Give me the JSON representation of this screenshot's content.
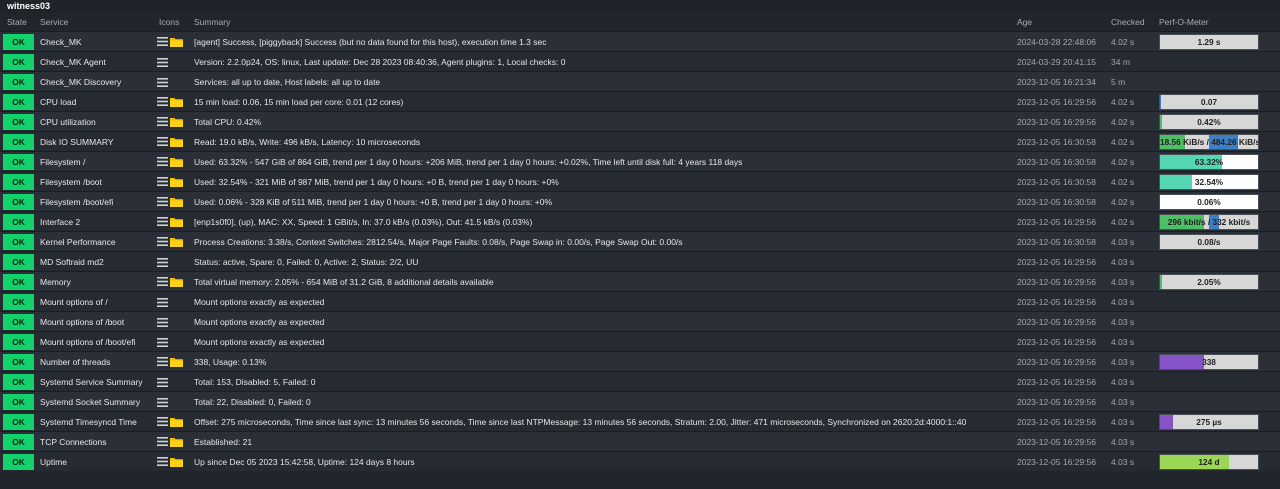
{
  "host": {
    "name": "witness03"
  },
  "columns": {
    "state": "State",
    "service": "Service",
    "icons": "Icons",
    "summary": "Summary",
    "age": "Age",
    "checked": "Checked",
    "perf": "Perf-O-Meter"
  },
  "ok_label": "OK",
  "colors": {
    "ok": "#14d26b",
    "perf_background": "#d7d7d7",
    "perf_teal": "#54d6b4",
    "perf_green": "#4fbf67",
    "perf_blue": "#3b7fc4",
    "perf_purple": "#8653c8",
    "perf_lime": "#9cd655"
  },
  "rows": [
    {
      "state": "OK",
      "service": "Check_MK",
      "icons": [
        "menu-icon",
        "folder-icon"
      ],
      "summary": "[agent] Success, [piggyback] Success (but no data found for this host), execution time 1.3 sec",
      "age": "2024-03-28 22:48:06",
      "checked": "4.02 s",
      "perf": {
        "text": "1.29 s",
        "fill": 0,
        "color": "#54d6b4"
      }
    },
    {
      "state": "OK",
      "service": "Check_MK Agent",
      "icons": [
        "menu-icon"
      ],
      "summary": "Version: 2.2.0p24, OS: linux, Last update: Dec 28 2023 08:40:36, Agent plugins: 1, Local checks: 0",
      "age": "2024-03-29 20:41:15",
      "checked": "34 m",
      "perf": null
    },
    {
      "state": "OK",
      "service": "Check_MK Discovery",
      "icons": [
        "menu-icon"
      ],
      "summary": "Services: all up to date, Host labels: all up to date",
      "age": "2023-12-05 16:21:34",
      "checked": "5 m",
      "perf": null
    },
    {
      "state": "OK",
      "service": "CPU load",
      "icons": [
        "menu-icon",
        "folder-icon"
      ],
      "summary": "15 min load: 0.06, 15 min load per core: 0.01 (12 cores)",
      "age": "2023-12-05 16:29:56",
      "checked": "4.02 s",
      "perf": {
        "text": "0.07",
        "fill": 0.01,
        "color": "#3b7fc4"
      }
    },
    {
      "state": "OK",
      "service": "CPU utilization",
      "icons": [
        "menu-icon",
        "folder-icon"
      ],
      "summary": "Total CPU: 0.42%",
      "age": "2023-12-05 16:29:56",
      "checked": "4.02 s",
      "perf": {
        "text": "0.42%",
        "fill": 0.02,
        "color": "#4fbf67"
      }
    },
    {
      "state": "OK",
      "service": "Disk IO SUMMARY",
      "icons": [
        "menu-icon",
        "folder-icon"
      ],
      "summary": "Read: 19.0 kB/s, Write: 496 kB/s, Latency: 10 microseconds",
      "age": "2023-12-05 16:30:58",
      "checked": "4.02 s",
      "perf": {
        "text": "18.56 KiB/s / 484.26 KiB/s",
        "fill": 0.25,
        "color": "#4fbf67",
        "fill2": 0.3,
        "color2": "#3b7fc4"
      }
    },
    {
      "state": "OK",
      "service": "Filesystem /",
      "icons": [
        "menu-icon",
        "folder-icon"
      ],
      "summary": "Used: 63.32% - 547 GiB of 864 GiB, trend per 1 day 0 hours: +206 MiB, trend per 1 day 0 hours: +0.02%, Time left until disk full: 4 years 118 days",
      "age": "2023-12-05 16:30:58",
      "checked": "4.02 s",
      "perf": {
        "text": "63.32%",
        "fill": 0.6332,
        "color": "#54d6b4",
        "bg": "#ffffff"
      }
    },
    {
      "state": "OK",
      "service": "Filesystem /boot",
      "icons": [
        "menu-icon",
        "folder-icon"
      ],
      "summary": "Used: 32.54% - 321 MiB of 987 MiB, trend per 1 day 0 hours: +0 B, trend per 1 day 0 hours: +0%",
      "age": "2023-12-05 16:30:58",
      "checked": "4.02 s",
      "perf": {
        "text": "32.54%",
        "fill": 0.3254,
        "color": "#54d6b4",
        "bg": "#ffffff"
      }
    },
    {
      "state": "OK",
      "service": "Filesystem /boot/efi",
      "icons": [
        "menu-icon",
        "folder-icon"
      ],
      "summary": "Used: 0.06% - 328 KiB of 511 MiB, trend per 1 day 0 hours: +0 B, trend per 1 day 0 hours: +0%",
      "age": "2023-12-05 16:30:58",
      "checked": "4.02 s",
      "perf": {
        "text": "0.06%",
        "fill": 0.0006,
        "color": "#54d6b4",
        "bg": "#ffffff"
      }
    },
    {
      "state": "OK",
      "service": "Interface 2",
      "icons": [
        "menu-icon",
        "folder-icon"
      ],
      "summary": "[enp1s0f0], (up), MAC: XX, Speed: 1 GBit/s, In: 37.0 kB/s (0.03%), Out: 41.5 kB/s (0.03%)",
      "age": "2023-12-05 16:29:56",
      "checked": "4.02 s",
      "perf": {
        "text": "296 kbit/s / 332 kbit/s",
        "fill": 0.45,
        "color": "#4fbf67",
        "fill2": 0.1,
        "color2": "#3b7fc4"
      }
    },
    {
      "state": "OK",
      "service": "Kernel Performance",
      "icons": [
        "menu-icon",
        "folder-icon"
      ],
      "summary": "Process Creations: 3.38/s, Context Switches: 2812.54/s, Major Page Faults: 0.08/s, Page Swap in: 0.00/s, Page Swap Out: 0.00/s",
      "age": "2023-12-05 16:30:58",
      "checked": "4.03 s",
      "perf": {
        "text": "0.08/s",
        "fill": 0,
        "color": "#54d6b4"
      }
    },
    {
      "state": "OK",
      "service": "MD Softraid md2",
      "icons": [
        "menu-icon"
      ],
      "summary": "Status: active, Spare: 0, Failed: 0, Active: 2, Status: 2/2, UU",
      "age": "2023-12-05 16:29:56",
      "checked": "4.03 s",
      "perf": null
    },
    {
      "state": "OK",
      "service": "Memory",
      "icons": [
        "menu-icon",
        "folder-icon"
      ],
      "summary": "Total virtual memory: 2.05% - 654 MiB of 31.2 GiB, 8 additional details available",
      "age": "2023-12-05 16:29:56",
      "checked": "4.03 s",
      "perf": {
        "text": "2.05%",
        "fill": 0.0205,
        "color": "#4fbf67"
      }
    },
    {
      "state": "OK",
      "service": "Mount options of /",
      "icons": [
        "menu-icon"
      ],
      "summary": "Mount options exactly as expected",
      "age": "2023-12-05 16:29:56",
      "checked": "4.03 s",
      "perf": null
    },
    {
      "state": "OK",
      "service": "Mount options of /boot",
      "icons": [
        "menu-icon"
      ],
      "summary": "Mount options exactly as expected",
      "age": "2023-12-05 16:29:56",
      "checked": "4.03 s",
      "perf": null
    },
    {
      "state": "OK",
      "service": "Mount options of /boot/efi",
      "icons": [
        "menu-icon"
      ],
      "summary": "Mount options exactly as expected",
      "age": "2023-12-05 16:29:56",
      "checked": "4.03 s",
      "perf": null
    },
    {
      "state": "OK",
      "service": "Number of threads",
      "icons": [
        "menu-icon",
        "folder-icon"
      ],
      "summary": "338, Usage: 0.13%",
      "age": "2023-12-05 16:29:56",
      "checked": "4.03 s",
      "perf": {
        "text": "338",
        "fill": 0.45,
        "color": "#8653c8"
      }
    },
    {
      "state": "OK",
      "service": "Systemd Service Summary",
      "icons": [
        "menu-icon"
      ],
      "summary": "Total: 153, Disabled: 5, Failed: 0",
      "age": "2023-12-05 16:29:56",
      "checked": "4.03 s",
      "perf": null
    },
    {
      "state": "OK",
      "service": "Systemd Socket Summary",
      "icons": [
        "menu-icon"
      ],
      "summary": "Total: 22, Disabled: 0, Failed: 0",
      "age": "2023-12-05 16:29:56",
      "checked": "4.03 s",
      "perf": null
    },
    {
      "state": "OK",
      "service": "Systemd Timesyncd Time",
      "icons": [
        "menu-icon",
        "folder-icon"
      ],
      "summary": "Offset: 275 microseconds, Time since last sync: 13 minutes 56 seconds, Time since last NTPMessage: 13 minutes 56 seconds, Stratum: 2.00, Jitter: 471 microseconds, Synchronized on 2620:2d:4000:1::40",
      "age": "2023-12-05 16:29:56",
      "checked": "4.03 s",
      "perf": {
        "text": "275 µs",
        "fill": 0.13,
        "color": "#8653c8"
      }
    },
    {
      "state": "OK",
      "service": "TCP Connections",
      "icons": [
        "menu-icon",
        "folder-icon"
      ],
      "summary": "Established: 21",
      "age": "2023-12-05 16:29:56",
      "checked": "4.03 s",
      "perf": null
    },
    {
      "state": "OK",
      "service": "Uptime",
      "icons": [
        "menu-icon",
        "folder-icon"
      ],
      "summary": "Up since Dec 05 2023 15:42:58, Uptime: 124 days 8 hours",
      "age": "2023-12-05 16:29:56",
      "checked": "4.03 s",
      "perf": {
        "text": "124 d",
        "fill": 0.7,
        "color": "#9cd655"
      }
    }
  ]
}
